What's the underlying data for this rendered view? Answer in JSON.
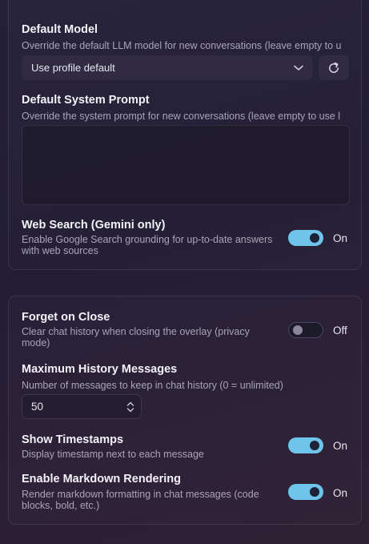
{
  "card_model": {
    "default_model": {
      "title": "Default Model",
      "description": "Override the default LLM model for new conversations (leave empty to u",
      "select_value": "Use profile default"
    },
    "system_prompt": {
      "title": "Default System Prompt",
      "description": "Override the system prompt for new conversations (leave empty to use l",
      "value": ""
    },
    "web_search": {
      "title": "Web Search (Gemini only)",
      "description_line1": "Enable Google Search grounding for up-to-date answers",
      "description_line2": "with web sources",
      "state": true,
      "state_label": "On"
    }
  },
  "card_history": {
    "forget_on_close": {
      "title": "Forget on Close",
      "description_line1": "Clear chat history when closing the overlay (privacy",
      "description_line2": "mode)",
      "state": false,
      "state_label": "Off"
    },
    "max_history": {
      "title": "Maximum History Messages",
      "description": "Number of messages to keep in chat history (0 = unlimited)",
      "value": "50"
    },
    "show_timestamps": {
      "title": "Show Timestamps",
      "description": "Display timestamp next to each message",
      "state": true,
      "state_label": "On"
    },
    "markdown": {
      "title": "Enable Markdown Rendering",
      "description_line1": "Render markdown formatting in chat messages (code",
      "description_line2": "blocks, bold, etc.)",
      "state": true,
      "state_label": "On"
    }
  },
  "colors": {
    "accent": "#6ec4ea",
    "background": "#231e34",
    "card_border": "rgba(255,255,255,0.09)"
  },
  "icons": {
    "select_chevron": "chevron-down-icon",
    "refresh": "refresh-icon",
    "stepper": "up-down-chevron-icon"
  }
}
